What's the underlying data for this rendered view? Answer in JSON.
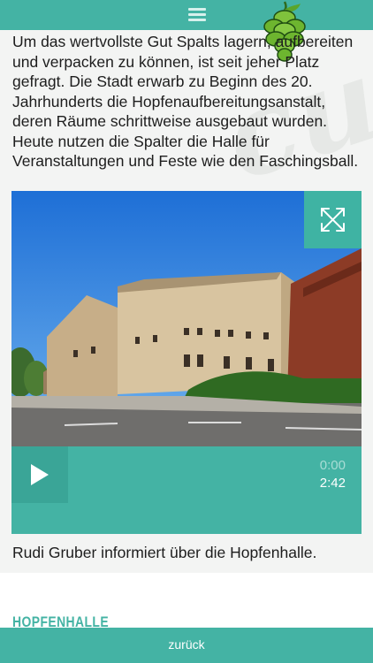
{
  "header": {
    "menu_icon": "hamburger-menu-icon",
    "logo_icon": "hop-cone-icon",
    "accent_color": "#44b3a4"
  },
  "article": {
    "body": "Um das wertvollste Gut Spalts lagern, aufbereiten und verpacken zu können, ist seit jeher Platz gefragt. Die Stadt erwarb zu Beginn des 20. Jahrhunderts die Hopfenaufbereitungsanstalt, deren Räume schrittweise ausgebaut wurden. Heute nutzen die Spalter die Halle für Veranstaltungen und Feste wie den Faschingsball."
  },
  "media": {
    "expand_icon": "fullscreen-expand-icon",
    "player": {
      "play_icon": "play-icon",
      "current_time": "0:00",
      "duration": "2:42"
    },
    "caption": "Rudi Gruber informiert über die Hopfenhalle."
  },
  "section": {
    "title": "HOPFENHALLE"
  },
  "footer": {
    "back_label": "zurück"
  }
}
